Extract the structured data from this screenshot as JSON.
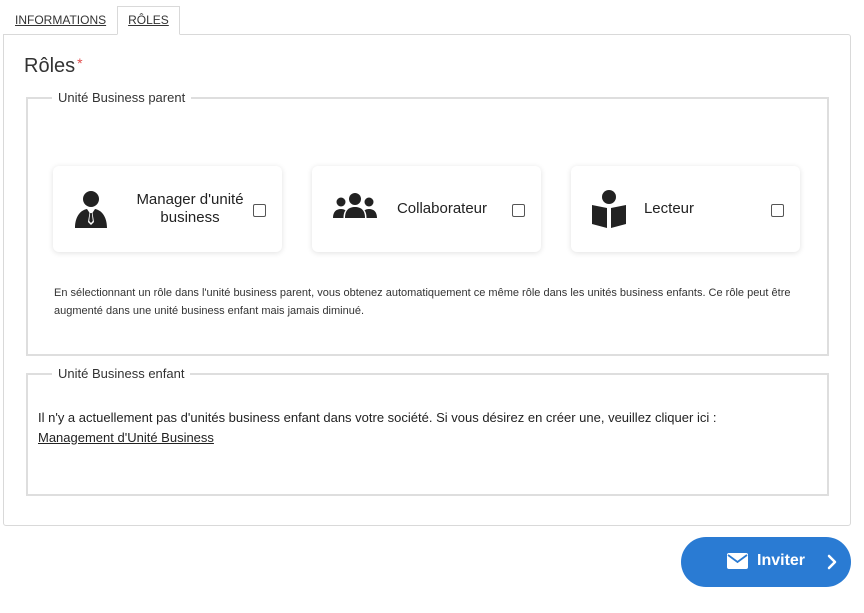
{
  "tabs": [
    {
      "label": "INFORMATIONS",
      "active": false
    },
    {
      "label": "RÔLES",
      "active": true
    }
  ],
  "roles": {
    "title": "Rôles",
    "required_mark": "*"
  },
  "parent_group": {
    "legend": "Unité Business parent",
    "cards": [
      {
        "label": "Manager d'unité business",
        "icon": "manager-icon",
        "checked": false
      },
      {
        "label": "Collaborateur",
        "icon": "team-icon",
        "checked": false
      },
      {
        "label": "Lecteur",
        "icon": "book-reader-icon",
        "checked": false
      }
    ],
    "note": "En sélectionnant un rôle dans l'unité business parent, vous obtenez automatiquement ce même rôle dans les unités business enfants. Ce rôle peut être augmenté dans une unité business enfant mais jamais diminué."
  },
  "child_group": {
    "legend": "Unité Business enfant",
    "text": "Il n'y a actuellement pas d'unités business enfant dans votre société. Si vous désirez en créer une, veuillez cliquer ici :",
    "link": "Management d'Unité Business"
  },
  "invite_button": {
    "label": "Inviter",
    "icon": "envelope-icon",
    "color": "#2a7bd3"
  }
}
